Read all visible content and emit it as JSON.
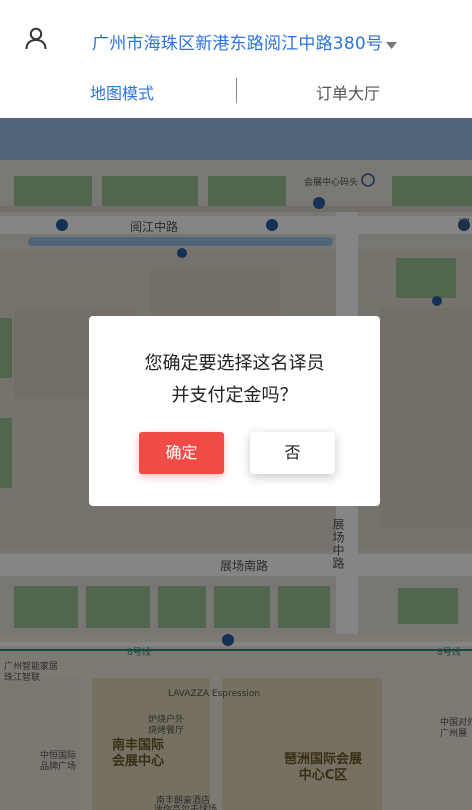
{
  "header": {
    "address": "广州市海珠区新港东路阅江中路380号",
    "tabs": {
      "map_mode": "地图模式",
      "order_hall": "订单大厅"
    }
  },
  "map": {
    "labels": {
      "pier": "会展中心码头",
      "road_yuejiang": "阅江中路",
      "road_yuejiang_edge": "阅",
      "road_zhanchang_south": "展场南路",
      "road_zhanchang_mid": "展场中路",
      "line8_left": "8号线",
      "line8_right": "8号线",
      "smarthome_l1": "广州智能家居",
      "smarthome_l2": "珠江智联",
      "lavazza": "LAVAZZA Espression",
      "restaurant_l1": "炉烧户外",
      "restaurant_l2": "烧烤餐厅",
      "nanfeng": "南丰国际\n会展中心",
      "pazhou": "琶洲国际会展\n中心C区",
      "zhongguo_l1": "中国对外",
      "zhongguo_l2": "广州展",
      "zhongyuan_l1": "中恒国际",
      "zhongyuan_l2": "品牌广场",
      "hotel_l1": "南丰朗豪酒店",
      "hotel_l2": "迷你高尔夫球场"
    }
  },
  "dialog": {
    "line1": "您确定要选择这名译员",
    "line2": "并支付定金吗？",
    "confirm_label": "确定",
    "no_label": "否"
  },
  "colors": {
    "accent_blue": "#2b73e0",
    "confirm_red": "#f24b46",
    "map_green": "#9bc497",
    "map_water": "#9ec0e8",
    "metro_line": "#2a8a7a"
  }
}
